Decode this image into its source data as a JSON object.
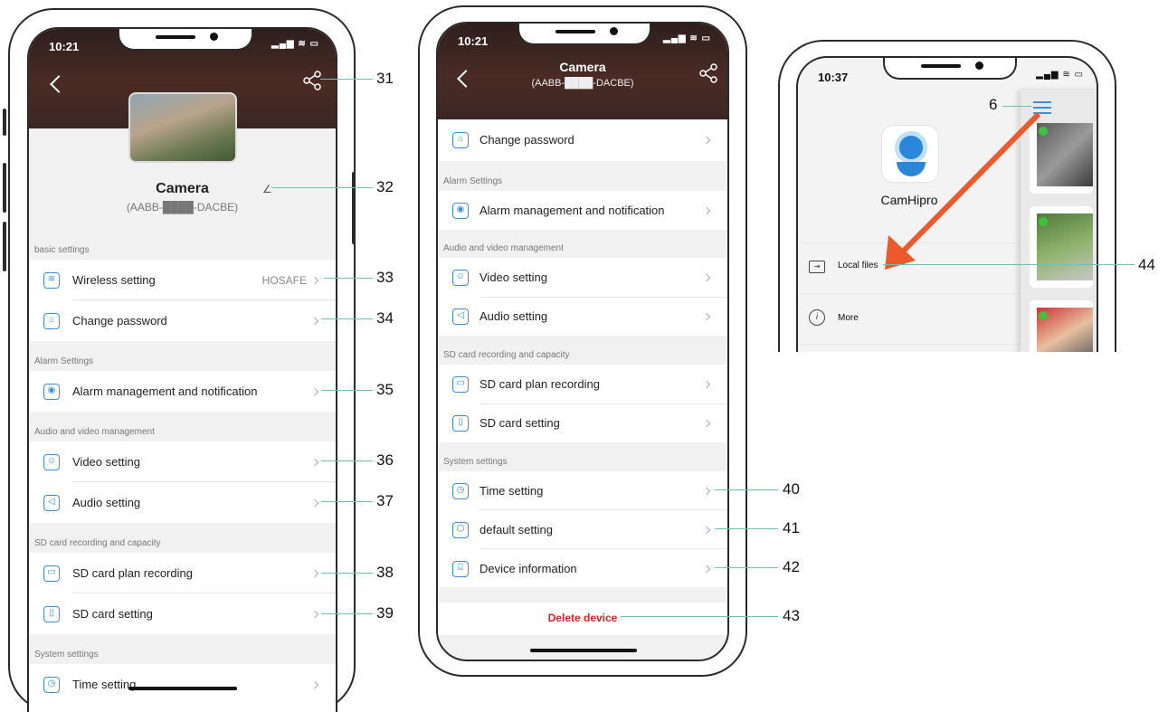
{
  "phone1": {
    "time": "10:21",
    "device_name": "Camera",
    "device_id": "(AABB-████-DACBE)",
    "sections": [
      {
        "header": "basic settings",
        "items": [
          {
            "label": "Wireless setting",
            "value": "HOSAFE",
            "icon": "wifi-icon"
          },
          {
            "label": "Change password",
            "value": "",
            "icon": "lock-icon"
          }
        ]
      },
      {
        "header": "Alarm Settings",
        "items": [
          {
            "label": "Alarm management and notification",
            "value": "",
            "icon": "alarm-icon"
          }
        ]
      },
      {
        "header": "Audio and video management",
        "items": [
          {
            "label": "Video setting",
            "value": "",
            "icon": "camera-icon"
          },
          {
            "label": "Audio setting",
            "value": "",
            "icon": "speaker-icon"
          }
        ]
      },
      {
        "header": "SD card recording and capacity",
        "items": [
          {
            "label": "SD card plan recording",
            "value": "",
            "icon": "record-icon"
          },
          {
            "label": "SD card setting",
            "value": "",
            "icon": "sdcard-icon"
          }
        ]
      },
      {
        "header": "System settings",
        "items": [
          {
            "label": "Time setting",
            "value": "",
            "icon": "clock-icon"
          }
        ]
      }
    ]
  },
  "phone2": {
    "time": "10:21",
    "title": "Camera",
    "subtitle": "(AABB-████-DACBE)",
    "sections": [
      {
        "header": "",
        "items": [
          {
            "label": "Change password",
            "icon": "lock-icon"
          }
        ]
      },
      {
        "header": "Alarm Settings",
        "items": [
          {
            "label": "Alarm management and notification",
            "icon": "alarm-icon"
          }
        ]
      },
      {
        "header": "Audio and video management",
        "items": [
          {
            "label": "Video setting",
            "icon": "camera-icon"
          },
          {
            "label": "Audio setting",
            "icon": "speaker-icon"
          }
        ]
      },
      {
        "header": "SD card recording and capacity",
        "items": [
          {
            "label": "SD card plan recording",
            "icon": "record-icon"
          },
          {
            "label": "SD card setting",
            "icon": "sdcard-icon"
          }
        ]
      },
      {
        "header": "System settings",
        "items": [
          {
            "label": "Time setting",
            "icon": "clock-icon"
          },
          {
            "label": "default setting",
            "icon": "reset-icon"
          },
          {
            "label": "Device information",
            "icon": "info-icon"
          }
        ]
      }
    ],
    "delete_label": "Delete device"
  },
  "phone3": {
    "time": "10:37",
    "app_name": "CamHipro",
    "menu": [
      {
        "label": "Local files",
        "icon": "folder-icon"
      },
      {
        "label": "More",
        "icon": "info-circle-icon"
      }
    ]
  },
  "callouts": {
    "c31": "31",
    "c32": "32",
    "c33": "33",
    "c34": "34",
    "c35": "35",
    "c36": "36",
    "c37": "37",
    "c38": "38",
    "c39": "39",
    "c40": "40",
    "c41": "41",
    "c42": "42",
    "c43": "43",
    "c6": "6",
    "c44": "44"
  },
  "colors": {
    "accent": "#3d8fd1",
    "delete": "#e02020",
    "callout_line": "#6cc1b6",
    "arrow": "#ec5a2c",
    "status_dot": "#3cc43c"
  }
}
